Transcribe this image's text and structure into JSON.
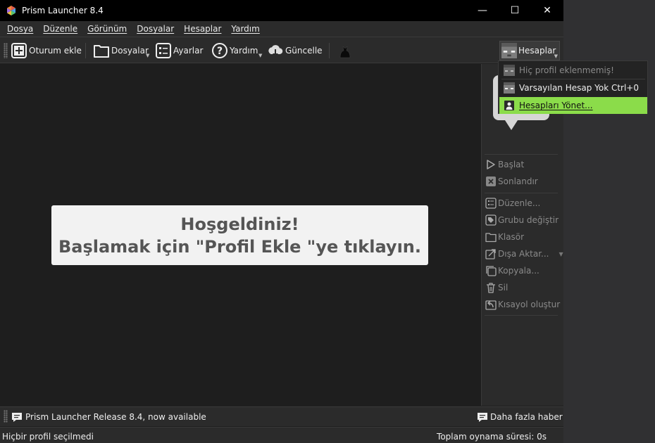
{
  "window": {
    "title": "Prism Launcher 8.4",
    "controls": {
      "minimize": "—",
      "maximize": "☐",
      "close": "✕"
    }
  },
  "menubar": {
    "items": [
      {
        "label": "Dosya"
      },
      {
        "label": "Düzenle"
      },
      {
        "label": "Görünüm"
      },
      {
        "label": "Dosyalar"
      },
      {
        "label": "Hesaplar"
      },
      {
        "label": "Yardım"
      }
    ]
  },
  "toolbar": {
    "add_instance": "Oturum ekle",
    "folders": "Dosyalar",
    "settings": "Ayarlar",
    "help": "Yardım",
    "update": "Güncelle",
    "accounts": "Hesaplar"
  },
  "welcome": {
    "line1": "Hoşgeldiniz!",
    "line2": "Başlamak için \"Profil Ekle \"ye tıklayın."
  },
  "sidebar": {
    "items": [
      {
        "label": "Başlat",
        "icon": "play-icon"
      },
      {
        "label": "Sonlandır",
        "icon": "kill-icon"
      },
      {
        "label": "Düzenle...",
        "icon": "edit-icon"
      },
      {
        "label": "Grubu değiştir",
        "icon": "tag-icon"
      },
      {
        "label": "Klasör",
        "icon": "folder-icon"
      },
      {
        "label": "Dışa Aktar...",
        "icon": "export-icon"
      },
      {
        "label": "Kopyala...",
        "icon": "copy-icon"
      },
      {
        "label": "Sil",
        "icon": "trash-icon"
      },
      {
        "label": "Kısayol oluştur",
        "icon": "shortcut-icon"
      }
    ]
  },
  "accounts_menu": {
    "no_profile": "Hiç profil eklenmemiş!",
    "default_account": "Varsayılan Hesap Yok",
    "default_shortcut": "Ctrl+0",
    "manage": "Hesapları Yönet..."
  },
  "newsbar": {
    "news": "Prism Launcher Release 8.4, now available",
    "more_news": "Daha fazla haber"
  },
  "statusbar": {
    "selected": "Hiçbir profil seçilmedi",
    "playtime": "Toplam oynama süresi: 0s"
  },
  "colors": {
    "highlight": "#8bdc4a",
    "background": "#1e1e1e",
    "toolbar": "#2b2b2b"
  }
}
